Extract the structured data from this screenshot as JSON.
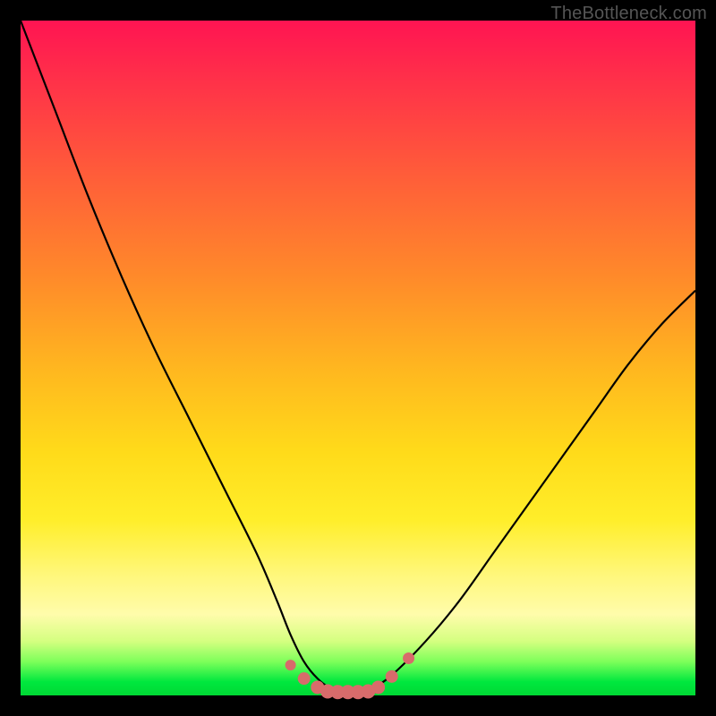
{
  "watermark": {
    "text": "TheBottleneck.com"
  },
  "colors": {
    "frame": "#000000",
    "curve": "#000000",
    "marker_fill": "#d86b6b",
    "marker_stroke": "#c65a5a"
  },
  "chart_data": {
    "type": "line",
    "title": "",
    "xlabel": "",
    "ylabel": "",
    "xlim": [
      0,
      100
    ],
    "ylim": [
      0,
      100
    ],
    "grid": false,
    "legend": false,
    "series": [
      {
        "name": "bottleneck-curve",
        "x": [
          0,
          5,
          10,
          15,
          20,
          25,
          30,
          35,
          38,
          40,
          42,
          44,
          46,
          48,
          50,
          52,
          55,
          60,
          65,
          70,
          75,
          80,
          85,
          90,
          95,
          100
        ],
        "values": [
          100,
          87,
          74,
          62,
          51,
          41,
          31,
          21,
          14,
          9,
          5,
          2.5,
          1,
          0.5,
          0.5,
          1,
          3,
          8,
          14,
          21,
          28,
          35,
          42,
          49,
          55,
          60
        ]
      }
    ],
    "markers": {
      "name": "optimal-range",
      "x": [
        40,
        42,
        44,
        45.5,
        47,
        48.5,
        50,
        51.5,
        53,
        55,
        57.5
      ],
      "values": [
        4.5,
        2.5,
        1.2,
        0.6,
        0.5,
        0.5,
        0.5,
        0.6,
        1.2,
        2.8,
        5.5
      ],
      "size": [
        6,
        7,
        7.5,
        8,
        8,
        8,
        8,
        8,
        7.5,
        7,
        6.5
      ]
    }
  }
}
